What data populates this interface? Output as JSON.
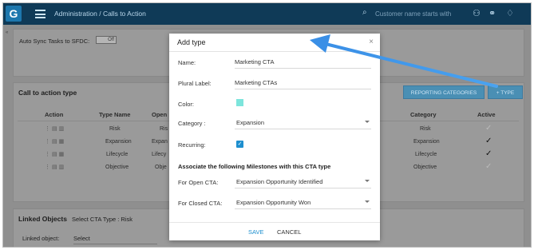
{
  "header": {
    "logo": "G",
    "breadcrumb": "Administration / Calls to Action",
    "search_placeholder": "Customer name starts with"
  },
  "background": {
    "autosync_label": "Auto Sync Tasks to SFDC:",
    "toggle_label": "Off",
    "cta_section_title": "Call to action type",
    "reporting_button": "REPORTING CATEGORIES",
    "add_type_button": "+ TYPE",
    "columns": {
      "action": "Action",
      "type_name": "Type Name",
      "open": "Open",
      "category": "Category",
      "active": "Active"
    },
    "rows": [
      {
        "type_name": "Risk",
        "open": "Ris",
        "category": "Risk",
        "active": "✓",
        "active_on": false
      },
      {
        "type_name": "Expansion",
        "open": "Expan",
        "category": "Expansion",
        "active": "✓",
        "active_on": true
      },
      {
        "type_name": "Lifecycle",
        "open": "Lifecy",
        "category": "Lifecycle",
        "active": "✓",
        "active_on": true
      },
      {
        "type_name": "Objective",
        "open": "Obje",
        "category": "Objective",
        "active": "✓",
        "active_on": false
      }
    ],
    "linked_title": "Linked Objects",
    "linked_subtitle": "Select CTA Type : Risk",
    "linked_object_label": "Linked object:",
    "linked_object_value": "Select"
  },
  "modal": {
    "title": "Add type",
    "close": "×",
    "name_label": "Name:",
    "name_value": "Marketing CTA",
    "plural_label": "Plural Label:",
    "plural_value": "Marketing CTAs",
    "color_label": "Color:",
    "color_value": "#7de5dc",
    "category_label": "Category :",
    "category_value": "Expansion",
    "recurring_label": "Recurring:",
    "recurring_checked": true,
    "assoc_heading": "Associate the following Milestones with this CTA type",
    "open_cta_label": "For Open CTA:",
    "open_cta_value": "Expansion Opportunity Identified",
    "closed_cta_label": "For Closed CTA:",
    "closed_cta_value": "Expansion Opportunity Won",
    "save_label": "SAVE",
    "cancel_label": "CANCEL"
  },
  "colors": {
    "topbar": "#0f3a57",
    "accent": "#1e90cf",
    "annotation_arrow": "#3a8fe6"
  }
}
